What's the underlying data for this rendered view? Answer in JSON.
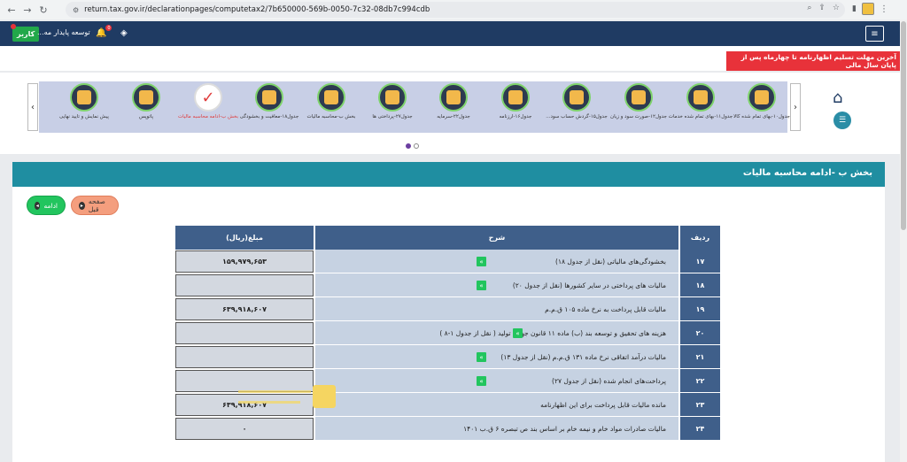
{
  "browser": {
    "url": "return.tax.gov.ir/declarationpages/computetax2/7b650000-569b-0050-7c32-08db7c994cdb"
  },
  "appbar": {
    "user_label": "کاربر",
    "company_name": "توسعه پایدار مه...",
    "notification_count": "0"
  },
  "alert": "آخرین مهلت تسلیم اظهارنامه تا چهارماه پس از پایان سال مالی",
  "carousel": {
    "items": [
      {
        "label": "جدول۱۰-بهای تمام شده کالا"
      },
      {
        "label": "جدول۱۱-بهای تمام شده خدمات"
      },
      {
        "label": "جدول۱۲-صورت سود و زیان"
      },
      {
        "label": "جدول۱۵-گردش حساب سود..."
      },
      {
        "label": "جدول۱۶-ارزنامه"
      },
      {
        "label": "جدول۲۲-سرمایه"
      },
      {
        "label": "جدول۲۷-پرداختی ها"
      },
      {
        "label": "بخش ب-محاسبه مالیات"
      },
      {
        "label": "جدول۱۸-معافیت و بخشودگی"
      },
      {
        "label": "بخش ب-ادامه محاسبه مالیات"
      },
      {
        "label": "پاتوپس"
      },
      {
        "label": "پیش نمایش و تایید نهایی"
      }
    ],
    "active_index": 9
  },
  "section": {
    "title": "بخش ب -ادامه محاسبه مالیات",
    "next_label": "ادامه",
    "prev_label": "صفحه قبل"
  },
  "table": {
    "headers": {
      "row": "ردیف",
      "desc": "شرح",
      "amount": "مبلغ(ریال)"
    },
    "rows": [
      {
        "num": "۱۷",
        "desc": "بخشودگی‌های مالیاتی (نقل از جدول ۱۸)",
        "amount": "۱۵۹,۹۷۹,۶۵۳",
        "check": true
      },
      {
        "num": "۱۸",
        "desc": "مالیات های پرداختی در سایر کشورها (نقل از جدول ۲۰)",
        "amount": "",
        "check": true
      },
      {
        "num": "۱۹",
        "desc": "مالیات قابل پرداخت به نرخ ماده ۱۰۵ ق.م.م",
        "amount": "۶۳۹,۹۱۸,۶۰۷",
        "check": false
      },
      {
        "num": "۲۰",
        "desc": "هزینه های تحقیق و توسعه بند (ب) ماده ۱۱ قانون جهش تولید ( نقل از جدول ۱-۸ )",
        "amount": "",
        "check": true
      },
      {
        "num": "۲۱",
        "desc": "مالیات درآمد اتفاقی نرخ ماده ۱۳۱ ق.م.م (نقل از جدول ۱۳)",
        "amount": "",
        "check": true
      },
      {
        "num": "۲۲",
        "desc": "پرداخت‌های انجام شده (نقل از جدول ۲۷)",
        "amount": "",
        "check": true
      },
      {
        "num": "۲۳",
        "desc": "مانده مالیات قابل پرداخت برای این اظهارنامه",
        "amount": "۶۳۹,۹۱۸,۶۰۷",
        "check": false
      },
      {
        "num": "۲۴",
        "desc": "مالیات صادرات مواد خام و نیمه خام بر اساس بند ص تبصره ۶ ق.ب ۱۴۰۱",
        "amount": "۰",
        "check": false
      }
    ]
  }
}
